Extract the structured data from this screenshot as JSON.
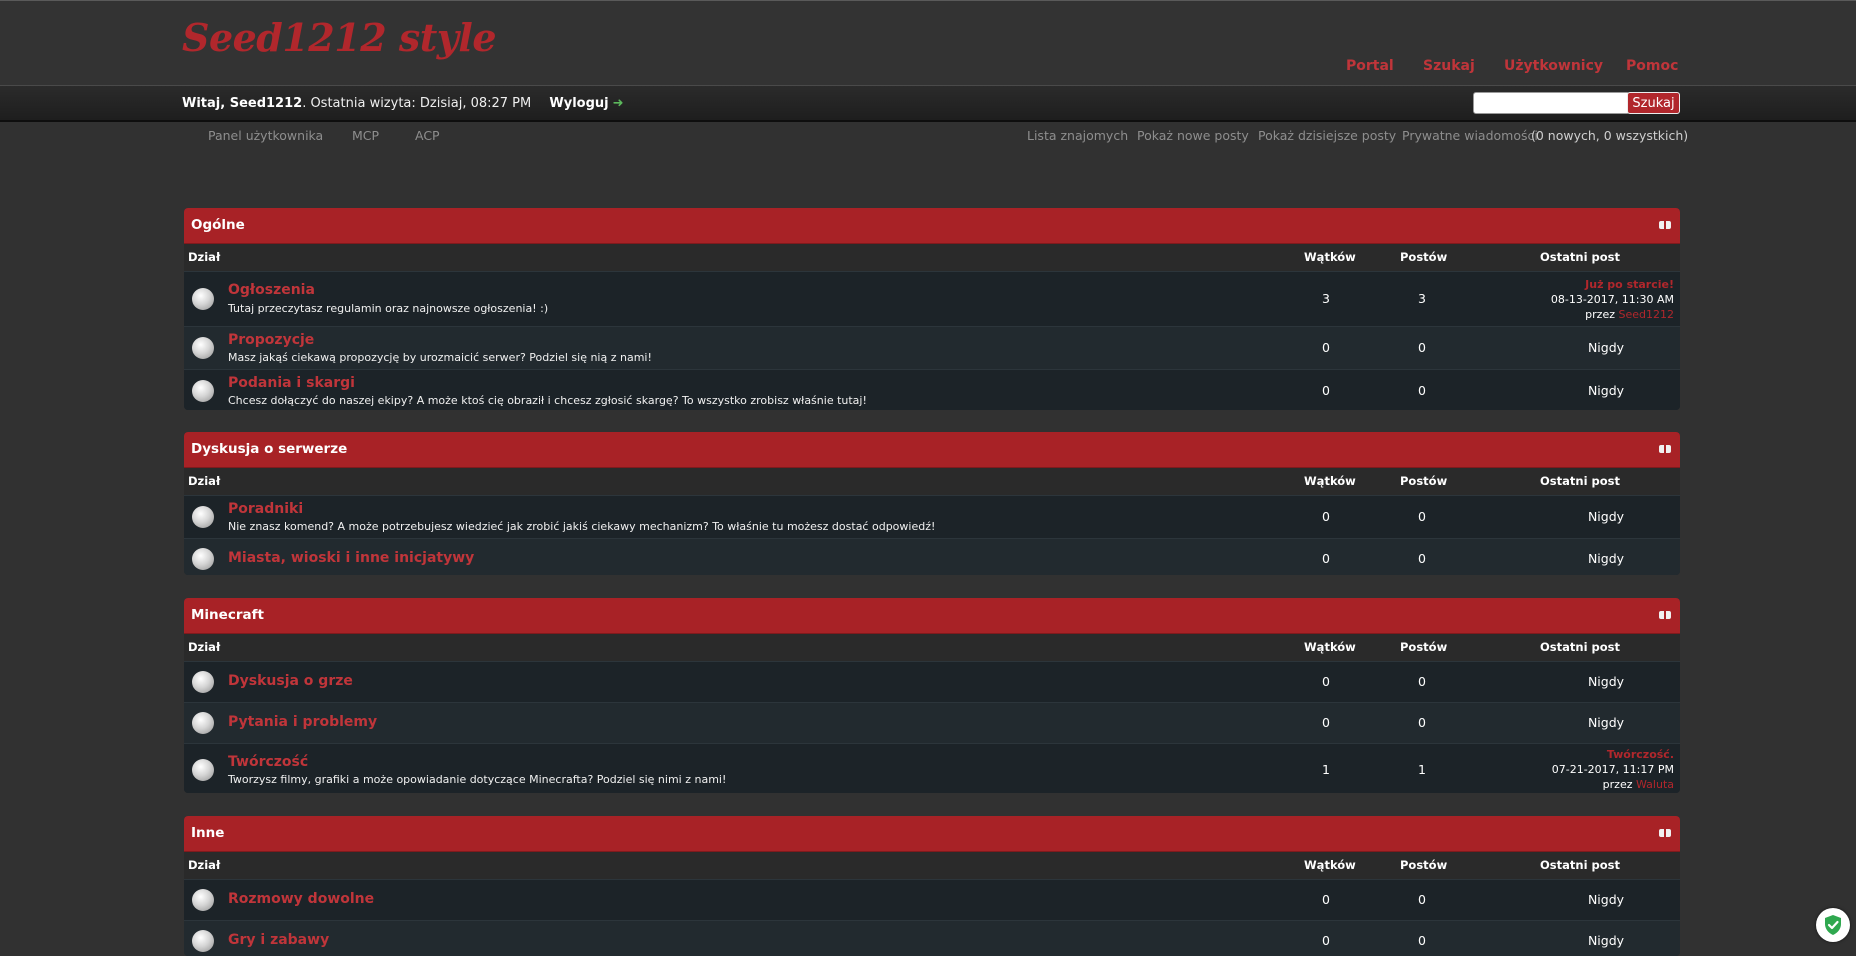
{
  "header": {
    "logo": "Seed1212 style",
    "nav": [
      "Portal",
      "Szukaj",
      "Użytkownicy",
      "Pomoc"
    ]
  },
  "welcome": {
    "greeting": "Witaj, Seed1212",
    "last_visit": ". Ostatnia wizyta: Dzisiaj, 08:27 PM",
    "logout": "Wyloguj",
    "search_button": "Szukaj",
    "search_value": ""
  },
  "userlinks": {
    "left": [
      "Panel użytkownika",
      "MCP",
      "ACP"
    ],
    "right": [
      "Lista znajomych",
      "Pokaż nowe posty",
      "Pokaż dzisiejsze posty",
      "Prywatne wiadomości"
    ],
    "pm_count": "(0 nowych, 0 wszystkich)"
  },
  "columns": {
    "forum": "Dział",
    "threads": "Wątków",
    "posts": "Postów",
    "last_post": "Ostatni post"
  },
  "never": "Nigdy",
  "by": "przez",
  "categories": [
    {
      "title": "Ogólne",
      "forums": [
        {
          "name": "Ogłoszenia",
          "desc": "Tutaj przeczytasz regulamin oraz najnowsze ogłoszenia! :)",
          "threads": "3",
          "posts": "3",
          "last": {
            "title": "Już po starcie!",
            "date": "08-13-2017, 11:30 AM",
            "user": "Seed1212"
          }
        },
        {
          "name": "Propozycje",
          "desc": "Masz jakąś ciekawą propozycję by urozmaicić serwer? Podziel się nią z nami!",
          "threads": "0",
          "posts": "0",
          "last": null
        },
        {
          "name": "Podania i skargi",
          "desc": "Chcesz dołączyć do naszej ekipy? A może ktoś cię obraził i chcesz zgłosić skargę? To wszystko zrobisz właśnie tutaj!",
          "threads": "0",
          "posts": "0",
          "last": null
        }
      ]
    },
    {
      "title": "Dyskusja o serwerze",
      "forums": [
        {
          "name": "Poradniki",
          "desc": "Nie znasz komend? A może potrzebujesz wiedzieć jak zrobić jakiś ciekawy mechanizm? To właśnie tu możesz dostać odpowiedź!",
          "threads": "0",
          "posts": "0",
          "last": null
        },
        {
          "name": "Miasta, wioski i inne inicjatywy",
          "desc": "",
          "threads": "0",
          "posts": "0",
          "last": null
        }
      ]
    },
    {
      "title": "Minecraft",
      "forums": [
        {
          "name": "Dyskusja o grze",
          "desc": "",
          "threads": "0",
          "posts": "0",
          "last": null
        },
        {
          "name": "Pytania i problemy",
          "desc": "",
          "threads": "0",
          "posts": "0",
          "last": null
        },
        {
          "name": "Twórczość",
          "desc": "Tworzysz filmy, grafiki a może opowiadanie dotyczące Minecrafta? Podziel się nimi z nami!",
          "threads": "1",
          "posts": "1",
          "last": {
            "title": "Twórczość.",
            "date": "07-21-2017, 11:17 PM",
            "user": "Waluta"
          }
        }
      ]
    },
    {
      "title": "Inne",
      "forums": [
        {
          "name": "Rozmowy dowolne",
          "desc": "",
          "threads": "0",
          "posts": "0",
          "last": null
        },
        {
          "name": "Gry i zabawy",
          "desc": "",
          "threads": "0",
          "posts": "0",
          "last": null
        }
      ]
    }
  ]
}
